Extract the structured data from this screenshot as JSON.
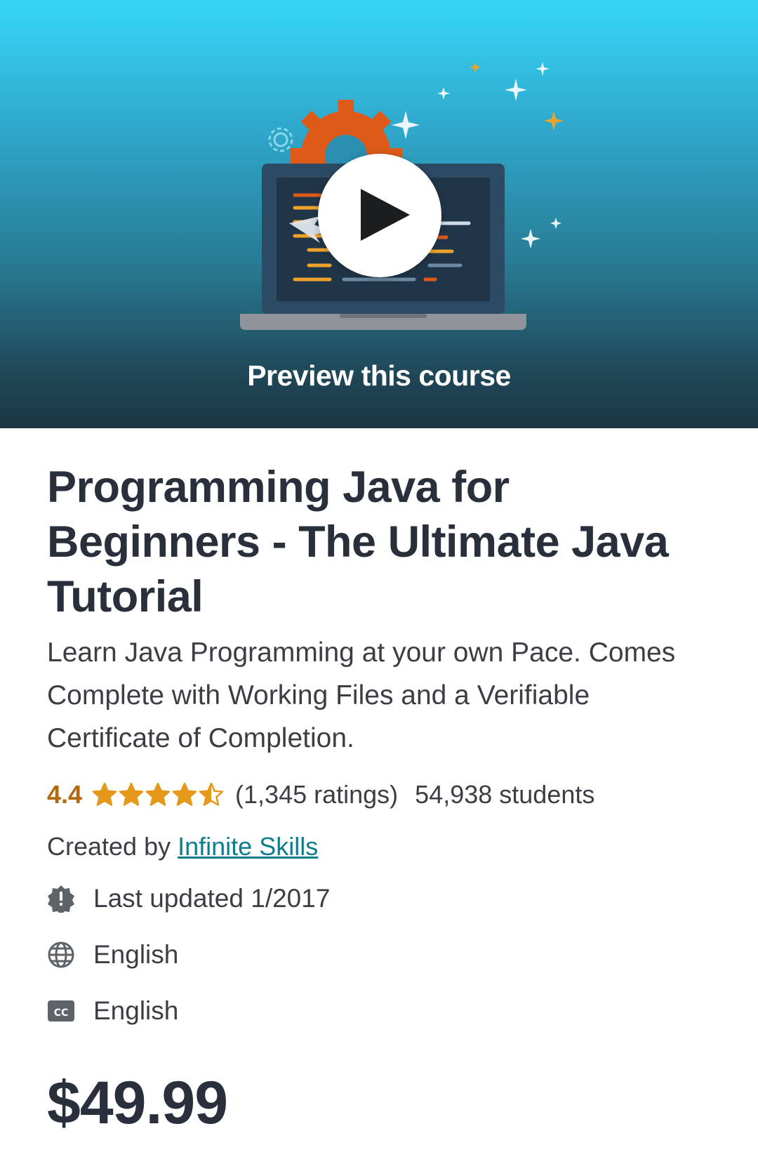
{
  "hero": {
    "preview_label": "Preview this course"
  },
  "course": {
    "title": "Programming Java for Beginners - The Ultimate Java Tutorial",
    "subtitle": "Learn Java Programming at your own Pace. Comes Complete with Working Files and a Verifiable Certificate of Completion.",
    "rating": "4.4",
    "rating_stars": 4.4,
    "ratings_count": "(1,345 ratings)",
    "students": "54,938 students",
    "created_by_label": "Created by",
    "author": "Infinite Skills",
    "last_updated": "Last updated 1/2017",
    "language": "English",
    "captions": "English",
    "price": "$49.99"
  },
  "colors": {
    "rating_orange": "#b4690e",
    "star_fill": "#e59819",
    "link_teal": "#0f7c90",
    "text_dark": "#29303b"
  },
  "icons": {
    "play": "play-icon",
    "star": "star-icon",
    "update": "alert-badge-icon",
    "language": "globe-icon",
    "captions": "closed-captions-icon"
  }
}
